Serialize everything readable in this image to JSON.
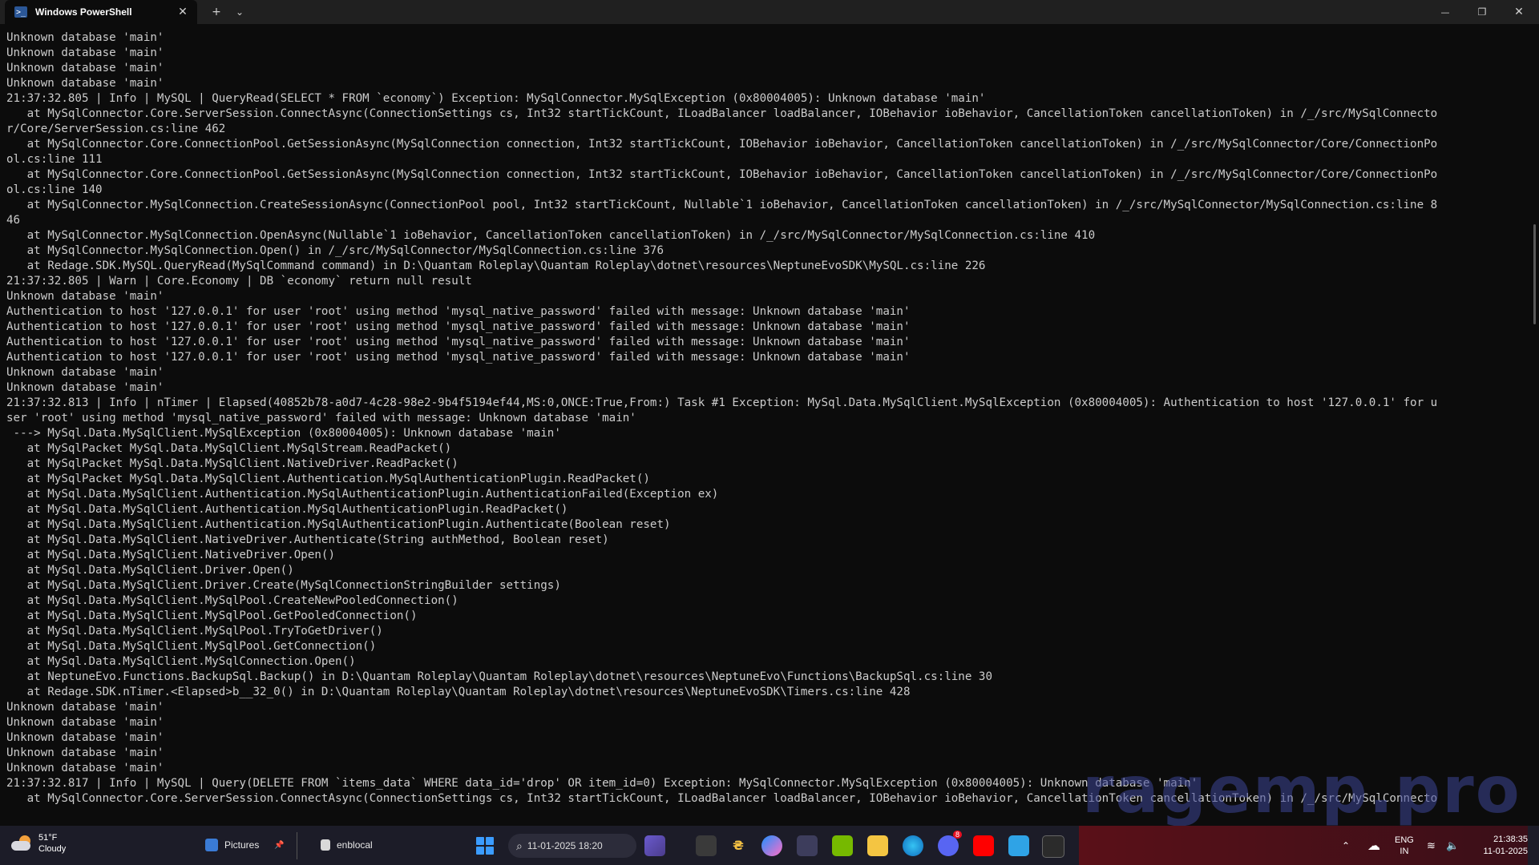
{
  "window": {
    "tab_title": "Windows PowerShell",
    "tab_icon_glyph": ">_",
    "tab_close": "✕",
    "new_tab": "+",
    "dropdown": "⌄",
    "minimize": "—",
    "maximize": "❐",
    "close": "✕"
  },
  "terminal": {
    "lines": [
      "Unknown database 'main'",
      "Unknown database 'main'",
      "Unknown database 'main'",
      "Unknown database 'main'",
      "21:37:32.805 | Info | MySQL | QueryRead(SELECT * FROM `economy`) Exception: MySqlConnector.MySqlException (0x80004005): Unknown database 'main'",
      "   at MySqlConnector.Core.ServerSession.ConnectAsync(ConnectionSettings cs, Int32 startTickCount, ILoadBalancer loadBalancer, IOBehavior ioBehavior, CancellationToken cancellationToken) in /_/src/MySqlConnecto",
      "r/Core/ServerSession.cs:line 462",
      "   at MySqlConnector.Core.ConnectionPool.GetSessionAsync(MySqlConnection connection, Int32 startTickCount, IOBehavior ioBehavior, CancellationToken cancellationToken) in /_/src/MySqlConnector/Core/ConnectionPo",
      "ol.cs:line 111",
      "   at MySqlConnector.Core.ConnectionPool.GetSessionAsync(MySqlConnection connection, Int32 startTickCount, IOBehavior ioBehavior, CancellationToken cancellationToken) in /_/src/MySqlConnector/Core/ConnectionPo",
      "ol.cs:line 140",
      "   at MySqlConnector.MySqlConnection.CreateSessionAsync(ConnectionPool pool, Int32 startTickCount, Nullable`1 ioBehavior, CancellationToken cancellationToken) in /_/src/MySqlConnector/MySqlConnection.cs:line 8",
      "46",
      "   at MySqlConnector.MySqlConnection.OpenAsync(Nullable`1 ioBehavior, CancellationToken cancellationToken) in /_/src/MySqlConnector/MySqlConnection.cs:line 410",
      "   at MySqlConnector.MySqlConnection.Open() in /_/src/MySqlConnector/MySqlConnection.cs:line 376",
      "   at Redage.SDK.MySQL.QueryRead(MySqlCommand command) in D:\\Quantam Roleplay\\Quantam Roleplay\\dotnet\\resources\\NeptuneEvoSDK\\MySQL.cs:line 226",
      "21:37:32.805 | Warn | Core.Economy | DB `economy` return null result",
      "Unknown database 'main'",
      "Authentication to host '127.0.0.1' for user 'root' using method 'mysql_native_password' failed with message: Unknown database 'main'",
      "Authentication to host '127.0.0.1' for user 'root' using method 'mysql_native_password' failed with message: Unknown database 'main'",
      "Authentication to host '127.0.0.1' for user 'root' using method 'mysql_native_password' failed with message: Unknown database 'main'",
      "Authentication to host '127.0.0.1' for user 'root' using method 'mysql_native_password' failed with message: Unknown database 'main'",
      "Unknown database 'main'",
      "Unknown database 'main'",
      "21:37:32.813 | Info | nTimer | Elapsed(40852b78-a0d7-4c28-98e2-9b4f5194ef44,MS:0,ONCE:True,From:) Task #1 Exception: MySql.Data.MySqlClient.MySqlException (0x80004005): Authentication to host '127.0.0.1' for u",
      "ser 'root' using method 'mysql_native_password' failed with message: Unknown database 'main'",
      " ---> MySql.Data.MySqlClient.MySqlException (0x80004005): Unknown database 'main'",
      "   at MySqlPacket MySql.Data.MySqlClient.MySqlStream.ReadPacket()",
      "   at MySqlPacket MySql.Data.MySqlClient.NativeDriver.ReadPacket()",
      "   at MySqlPacket MySql.Data.MySqlClient.Authentication.MySqlAuthenticationPlugin.ReadPacket()",
      "   at MySql.Data.MySqlClient.Authentication.MySqlAuthenticationPlugin.AuthenticationFailed(Exception ex)",
      "   at MySql.Data.MySqlClient.Authentication.MySqlAuthenticationPlugin.ReadPacket()",
      "   at MySql.Data.MySqlClient.Authentication.MySqlAuthenticationPlugin.Authenticate(Boolean reset)",
      "   at MySql.Data.MySqlClient.NativeDriver.Authenticate(String authMethod, Boolean reset)",
      "   at MySql.Data.MySqlClient.NativeDriver.Open()",
      "   at MySql.Data.MySqlClient.Driver.Open()",
      "   at MySql.Data.MySqlClient.Driver.Create(MySqlConnectionStringBuilder settings)",
      "   at MySql.Data.MySqlClient.MySqlPool.CreateNewPooledConnection()",
      "   at MySql.Data.MySqlClient.MySqlPool.GetPooledConnection()",
      "   at MySql.Data.MySqlClient.MySqlPool.TryToGetDriver()",
      "   at MySql.Data.MySqlClient.MySqlPool.GetConnection()",
      "   at MySql.Data.MySqlClient.MySqlConnection.Open()",
      "   at NeptuneEvo.Functions.BackupSql.Backup() in D:\\Quantam Roleplay\\Quantam Roleplay\\dotnet\\resources\\NeptuneEvo\\Functions\\BackupSql.cs:line 30",
      "   at Redage.SDK.nTimer.<Elapsed>b__32_0() in D:\\Quantam Roleplay\\Quantam Roleplay\\dotnet\\resources\\NeptuneEvoSDK\\Timers.cs:line 428",
      "Unknown database 'main'",
      "Unknown database 'main'",
      "Unknown database 'main'",
      "Unknown database 'main'",
      "Unknown database 'main'",
      "21:37:32.817 | Info | MySQL | Query(DELETE FROM `items_data` WHERE data_id='drop' OR item_id=0) Exception: MySqlConnector.MySqlException (0x80004005): Unknown database 'main'",
      "   at MySqlConnector.Core.ServerSession.ConnectAsync(ConnectionSettings cs, Int32 startTickCount, ILoadBalancer loadBalancer, IOBehavior ioBehavior, CancellationToken cancellationToken) in /_/src/MySqlConnecto"
    ]
  },
  "watermark": "ragemp.pro",
  "taskbar": {
    "weather": {
      "temp": "51°F",
      "condition": "Cloudy"
    },
    "pictures_label": "Pictures",
    "enblocal_label": "enblocal",
    "search_label": "11-01-2025 18:20",
    "clock": {
      "time": "21:38:35",
      "date": "11-01-2025"
    },
    "lang": {
      "line1": "ENG",
      "line2": "IN"
    },
    "discord_badge": "8",
    "colors": {
      "accent": "#3b9cff",
      "tray_red": "#5a1018"
    }
  }
}
